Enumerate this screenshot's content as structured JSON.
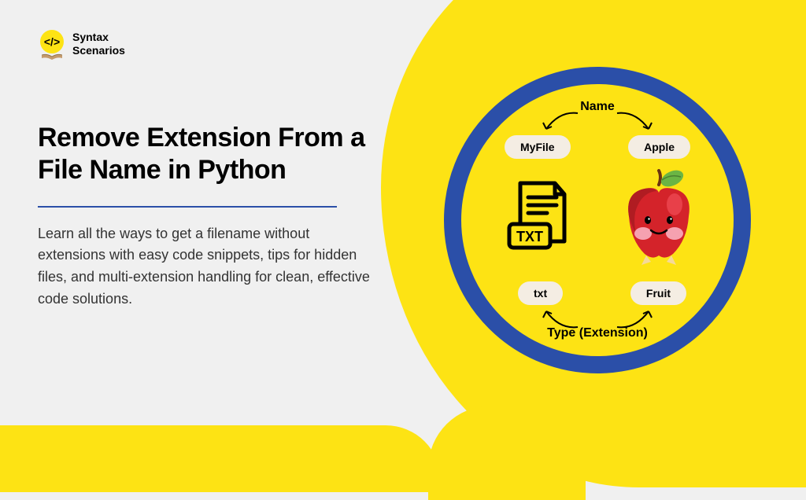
{
  "logo": {
    "line1": "Syntax",
    "line2": "Scenarios"
  },
  "title": "Remove Extension From a File Name in Python",
  "description": "Learn all the ways to get a filename without extensions with easy code snippets, tips for hidden files, and multi-extension handling for clean, effective code solutions.",
  "diagram": {
    "topLabel": "Name",
    "bottomLabel": "Type (Extension)",
    "pill1": "MyFile",
    "pill2": "Apple",
    "pill3": "txt",
    "pill4": "Fruit"
  }
}
